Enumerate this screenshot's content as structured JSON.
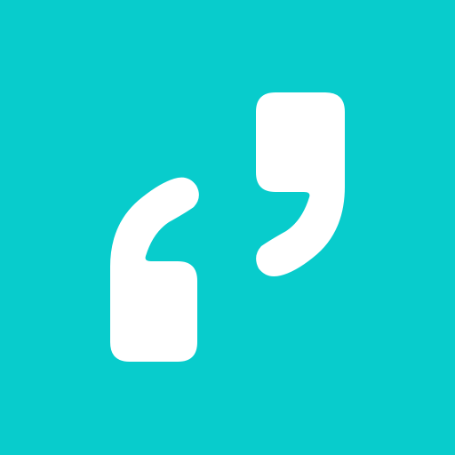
{
  "app_icon": {
    "icon_name": "quote-marks-icon",
    "colors": {
      "background": "#08CCCC",
      "glyph": "#FFFFFF"
    }
  }
}
